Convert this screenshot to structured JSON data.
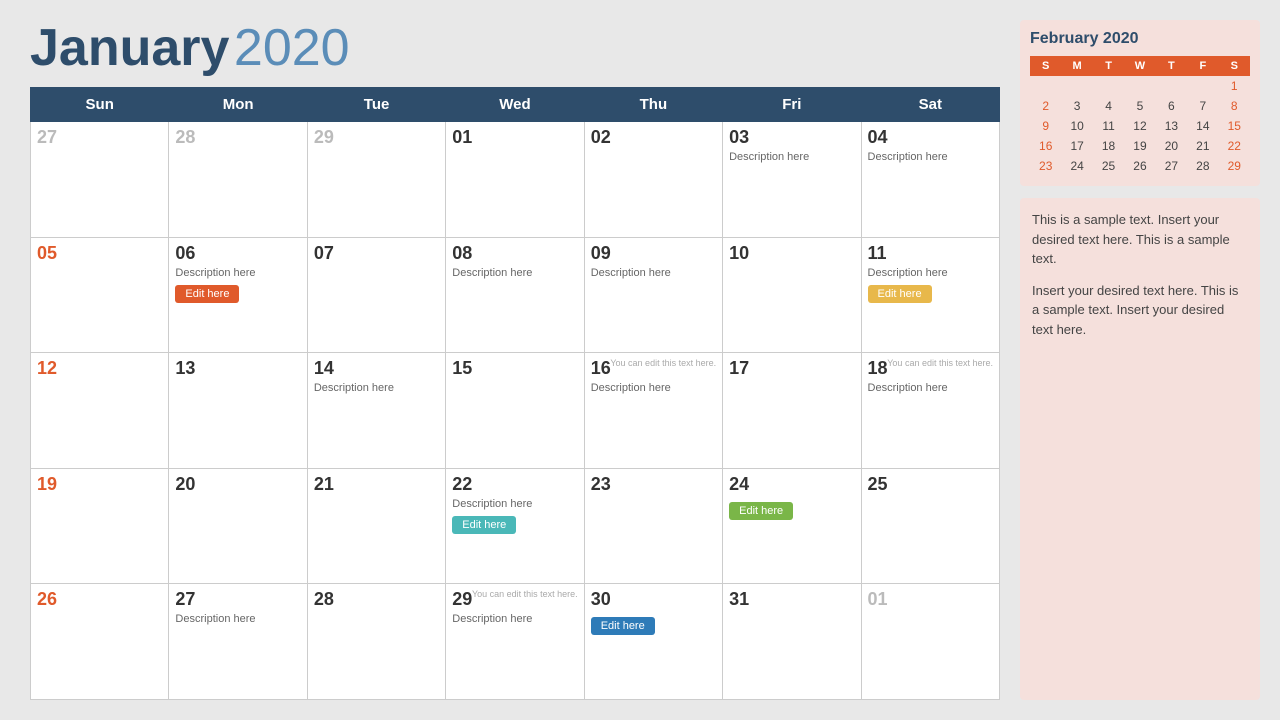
{
  "main": {
    "title_month": "January",
    "title_year": "2020",
    "weekdays": [
      "Sun",
      "Mon",
      "Tue",
      "Wed",
      "Thu",
      "Fri",
      "Sat"
    ],
    "weeks": [
      [
        {
          "num": "27",
          "type": "other",
          "desc": "",
          "btn": null,
          "note": null
        },
        {
          "num": "28",
          "type": "other",
          "desc": "",
          "btn": null,
          "note": null
        },
        {
          "num": "29",
          "type": "other",
          "desc": "",
          "btn": null,
          "note": null
        },
        {
          "num": "01",
          "type": "current",
          "desc": "",
          "btn": null,
          "note": null
        },
        {
          "num": "02",
          "type": "current",
          "desc": "",
          "btn": null,
          "note": null
        },
        {
          "num": "03",
          "type": "current",
          "desc": "Description here",
          "btn": null,
          "note": null
        },
        {
          "num": "04",
          "type": "current",
          "desc": "Description here",
          "btn": null,
          "note": null
        }
      ],
      [
        {
          "num": "05",
          "type": "sunday",
          "desc": "",
          "btn": null,
          "note": null
        },
        {
          "num": "06",
          "type": "current",
          "desc": "Description here",
          "btn": {
            "label": "Edit here",
            "color": "btn-orange"
          },
          "note": null
        },
        {
          "num": "07",
          "type": "current",
          "desc": "",
          "btn": null,
          "note": null
        },
        {
          "num": "08",
          "type": "current",
          "desc": "Description here",
          "btn": null,
          "note": null
        },
        {
          "num": "09",
          "type": "current",
          "desc": "Description here",
          "btn": null,
          "note": null
        },
        {
          "num": "10",
          "type": "current",
          "desc": "",
          "btn": null,
          "note": null
        },
        {
          "num": "11",
          "type": "current",
          "desc": "Description here",
          "btn": {
            "label": "Edit here",
            "color": "btn-yellow"
          },
          "note": null
        }
      ],
      [
        {
          "num": "12",
          "type": "sunday",
          "desc": "",
          "btn": null,
          "note": null
        },
        {
          "num": "13",
          "type": "current",
          "desc": "",
          "btn": null,
          "note": null
        },
        {
          "num": "14",
          "type": "current",
          "desc": "Description here",
          "btn": null,
          "note": null
        },
        {
          "num": "15",
          "type": "current",
          "desc": "",
          "btn": null,
          "note": null
        },
        {
          "num": "16",
          "type": "current",
          "desc": "Description here",
          "btn": null,
          "note": "You can edit this text here."
        },
        {
          "num": "17",
          "type": "current",
          "desc": "",
          "btn": null,
          "note": null
        },
        {
          "num": "18",
          "type": "current",
          "desc": "Description here",
          "btn": null,
          "note": "You can edit this text here."
        }
      ],
      [
        {
          "num": "19",
          "type": "sunday",
          "desc": "",
          "btn": null,
          "note": null
        },
        {
          "num": "20",
          "type": "current",
          "desc": "",
          "btn": null,
          "note": null
        },
        {
          "num": "21",
          "type": "current",
          "desc": "",
          "btn": null,
          "note": null
        },
        {
          "num": "22",
          "type": "current",
          "desc": "Description here",
          "btn": {
            "label": "Edit here",
            "color": "btn-teal"
          },
          "note": null
        },
        {
          "num": "23",
          "type": "current",
          "desc": "",
          "btn": null,
          "note": null
        },
        {
          "num": "24",
          "type": "current",
          "desc": "",
          "btn": {
            "label": "Edit here",
            "color": "btn-green"
          },
          "note": null
        },
        {
          "num": "25",
          "type": "current",
          "desc": "",
          "btn": null,
          "note": null
        }
      ],
      [
        {
          "num": "26",
          "type": "sunday",
          "desc": "",
          "btn": null,
          "note": null
        },
        {
          "num": "27",
          "type": "current",
          "desc": "Description here",
          "btn": null,
          "note": null
        },
        {
          "num": "28",
          "type": "current",
          "desc": "",
          "btn": null,
          "note": null
        },
        {
          "num": "29",
          "type": "current",
          "desc": "Description here",
          "btn": null,
          "note": "You can edit this text here."
        },
        {
          "num": "30",
          "type": "current",
          "desc": "",
          "btn": {
            "label": "Edit here",
            "color": "btn-blue"
          },
          "note": null
        },
        {
          "num": "31",
          "type": "current",
          "desc": "",
          "btn": null,
          "note": null
        },
        {
          "num": "01",
          "type": "other",
          "desc": "",
          "btn": null,
          "note": null
        }
      ]
    ]
  },
  "side": {
    "mini_title": "February 2020",
    "mini_days": [
      "S",
      "M",
      "T",
      "W",
      "T",
      "F",
      "S"
    ],
    "mini_weeks": [
      [
        "",
        "",
        "",
        "",
        "",
        "",
        "1"
      ],
      [
        "2",
        "3",
        "4",
        "5",
        "6",
        "7",
        "8"
      ],
      [
        "9",
        "10",
        "11",
        "12",
        "13",
        "14",
        "15"
      ],
      [
        "16",
        "17",
        "18",
        "19",
        "20",
        "21",
        "22"
      ],
      [
        "23",
        "24",
        "25",
        "26",
        "27",
        "28",
        "29"
      ]
    ],
    "para1": "This is a sample text. Insert your desired text here. This is a sample text.",
    "para2": "Insert your desired text here. This is a sample text. Insert your desired text here."
  }
}
